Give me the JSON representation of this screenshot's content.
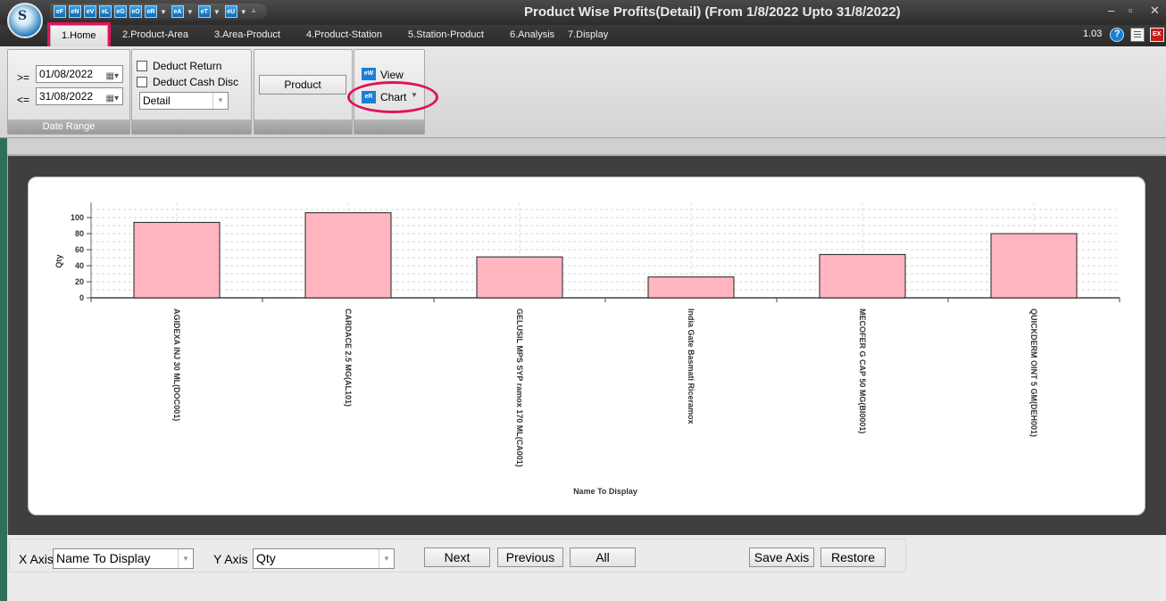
{
  "window": {
    "title": "Product Wise Profits(Detail) (From 1/8/2022 Upto 31/8/2022)",
    "controls": [
      "–",
      "▫",
      "✕"
    ]
  },
  "app": {
    "logo_text": "S"
  },
  "quick_access": {
    "buttons": [
      "eF",
      "eN",
      "eV",
      "eL",
      "eG",
      "eO",
      "eR",
      "eA",
      "eT",
      "eU"
    ]
  },
  "tabs": [
    "1.Home",
    "2.Product-Area",
    "3.Area-Product",
    "4.Product-Station",
    "5.Station-Product",
    "6.Analysis",
    "7.Display"
  ],
  "active_tab": "1.Home",
  "version": "1.03",
  "ribbon": {
    "date_range": {
      "from_op": ">=",
      "from_value": "01/08/2022",
      "to_op": "<=",
      "to_value": "31/08/2022",
      "group_label": "Date Range"
    },
    "options": {
      "deduct_return": "Deduct Return",
      "deduct_cash_disc": "Deduct Cash Disc",
      "mode_value": "Detail"
    },
    "product_button": "Product",
    "view_label": "View",
    "chart_label": "Chart",
    "view_icon": "eW",
    "chart_icon": "eR"
  },
  "chart_data": {
    "type": "bar",
    "categories": [
      "AGIDEXA INJ 30 ML(DOC001)",
      "CARDACE 2.5 MG(AL101)",
      "GELUSIL MPS SYP ramox 170 ML(CA001)",
      "India Gate Basmati Riceramox",
      "MECOFER G CAP 50 MG(BI0001)",
      "QUICKDERM OINT 5 GM(DEH001)"
    ],
    "values": [
      94,
      106,
      51,
      26,
      54,
      80
    ],
    "xlabel": "Name To Display",
    "ylabel": "Qty",
    "ylim": [
      0,
      100
    ],
    "yticks": [
      0,
      20,
      40,
      60,
      80,
      100
    ],
    "grid": true,
    "bar_color": "#ffb6c1"
  },
  "bottom": {
    "x_axis_label": "X Axis",
    "x_axis_value": "Name To Display",
    "y_axis_label": "Y Axis",
    "y_axis_value": "Qty",
    "next": "Next",
    "previous": "Previous",
    "all": "All",
    "save_axis": "Save Axis",
    "restore": "Restore"
  },
  "colors": {
    "highlight": "#e2115a",
    "title_bar": "#2c2c2c",
    "accent_blue": "#1a7fd4"
  }
}
